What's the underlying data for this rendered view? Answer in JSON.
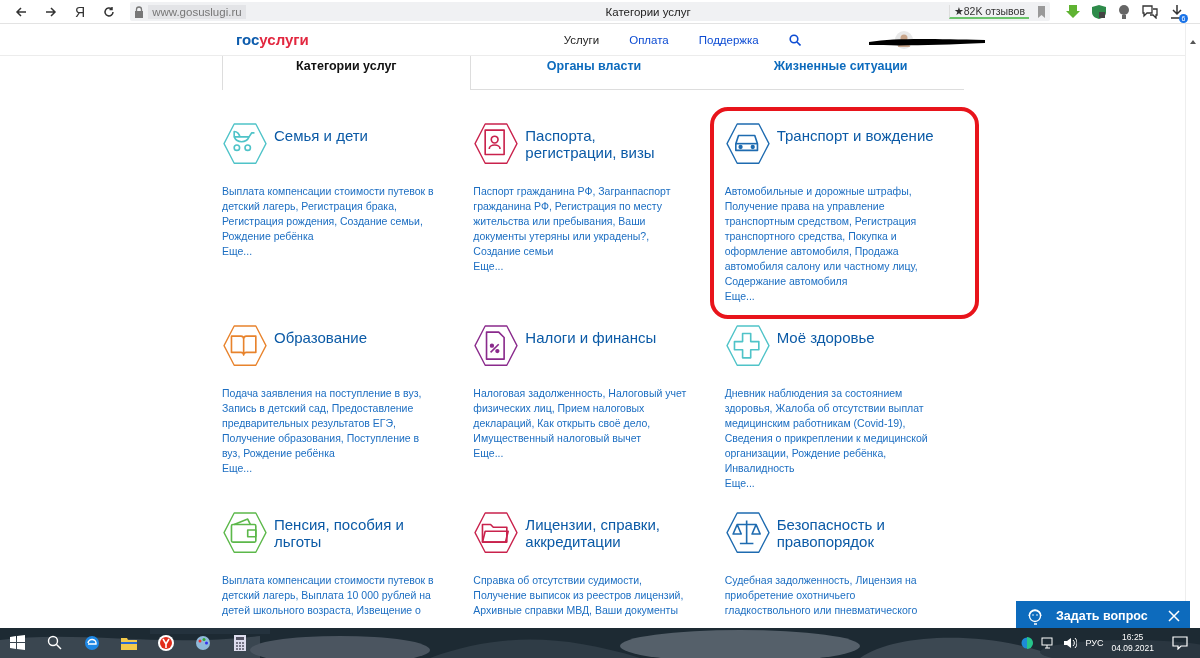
{
  "browser": {
    "yandex_button": "Я",
    "url": "www.gosuslugi.ru",
    "tab_title": "Категории услуг",
    "rating": "★82K отзывов",
    "downloads_badge": "6"
  },
  "header": {
    "logo_part_1": "гос",
    "logo_part_2": "услуги",
    "nav": [
      {
        "label": "Услуги",
        "selected": true
      },
      {
        "label": "Оплата",
        "selected": false
      },
      {
        "label": "Поддержка",
        "selected": false
      }
    ]
  },
  "tabs": [
    {
      "label": "Категории услуг",
      "selected": true
    },
    {
      "label": "Органы власти",
      "selected": false
    },
    {
      "label": "Жизненные ситуации",
      "selected": false
    }
  ],
  "categories": [
    {
      "title": "Семья и дети",
      "description": "Выплата компенсации стоимости путевок в детский лагерь, Регистрация брака, Регистрация рождения, Создание семьи, Рождение ребёнка",
      "more": "Еще...",
      "color": "#4fc3c8",
      "highlighted": false
    },
    {
      "title": "Паспорта, регистрации, визы",
      "description": "Паспорт гражданина РФ, Загранпаспорт гражданина РФ, Регистрация по месту жительства или пребывания, Ваши документы утеряны или украдены?, Создание семьи",
      "more": "Еще...",
      "color": "#c9224c",
      "highlighted": false
    },
    {
      "title": "Транспорт и вождение",
      "description": "Автомобильные и дорожные штрафы, Получение права на управление транспортным средством, Регистрация транспортного средства, Покупка и оформление автомобиля, Продажа автомобиля салону или частному лицу, Содержание автомобиля",
      "more": "Еще...",
      "color": "#1e6bb0",
      "highlighted": true
    },
    {
      "title": "Образование",
      "description": "Подача заявления на поступление в вуз, Запись в детский сад, Предоставление предварительных результатов ЕГЭ, Получение образования, Поступление в вуз, Рождение ребёнка",
      "more": "Еще...",
      "color": "#e8832c",
      "highlighted": false
    },
    {
      "title": "Налоги и финансы",
      "description": "Налоговая задолженность, Налоговый учет физических лиц, Прием налоговых деклараций, Как открыть своё дело, Имущественный налоговый вычет",
      "more": "Еще...",
      "color": "#8a2a8c",
      "highlighted": false
    },
    {
      "title": "Моё здоровье",
      "description": "Дневник наблюдения за состоянием здоровья, Жалоба об отсутствии выплат медицинским работникам (Covid-19), Сведения о прикреплении к медицинской организации, Рождение ребёнка, Инвалидность",
      "more": "Еще...",
      "color": "#4fc3c8",
      "highlighted": false
    },
    {
      "title": "Пенсия, пособия и льготы",
      "description": "Выплата компенсации стоимости путевок в детский лагерь, Выплата 10 000 рублей на детей школьного возраста, Извещение о",
      "color": "#5cb84a",
      "highlighted": false
    },
    {
      "title": "Лицензии, справки, аккредитации",
      "description": "Справка об отсутствии судимости, Получение выписок из реестров лицензий, Архивные справки МВД, Ваши документы",
      "color": "#c9224c",
      "highlighted": false
    },
    {
      "title": "Безопасность и правопорядок",
      "description": "Судебная задолженность, Лицензия на приобретение охотничьего гладкоствольного или пневматического",
      "color": "#1e6bb0",
      "highlighted": false
    }
  ],
  "chat": {
    "label": "Задать вопрос"
  },
  "taskbar": {
    "language": "РУС",
    "time": "16:25",
    "date": "04.09.2021"
  }
}
